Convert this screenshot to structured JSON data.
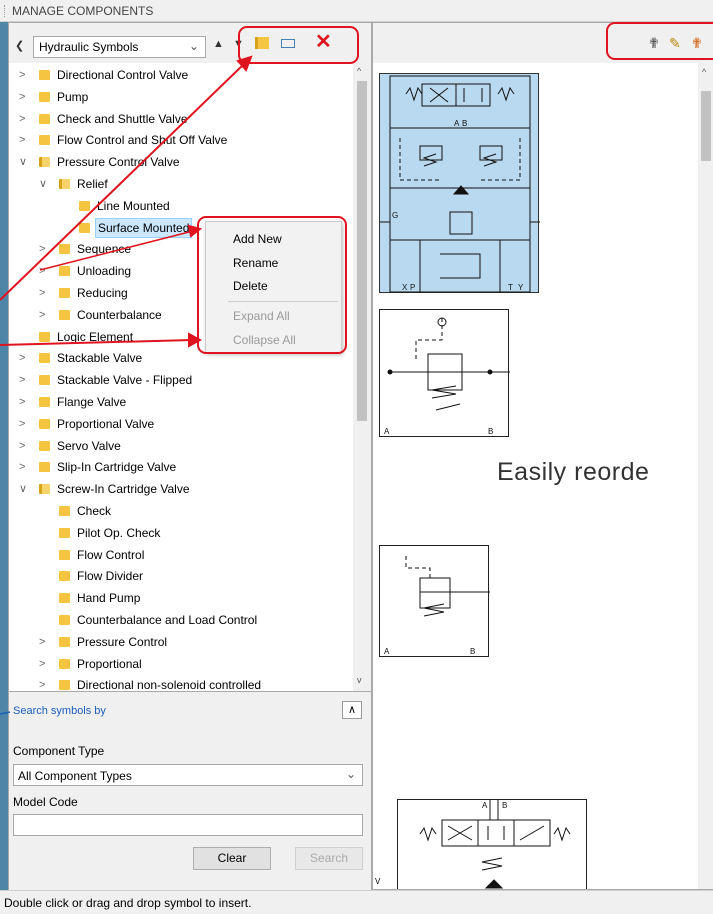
{
  "window": {
    "title": "MANAGE COMPONENTS",
    "status": "Double click or drag and drop symbol to insert."
  },
  "toolbar": {
    "library": "Hydraulic Symbols"
  },
  "tree": [
    {
      "label": "Directional Control Valve",
      "depth": 0,
      "expanded": false
    },
    {
      "label": "Pump",
      "depth": 0,
      "expanded": false
    },
    {
      "label": "Check and Shuttle Valve",
      "depth": 0,
      "expanded": false
    },
    {
      "label": "Flow Control and Shut Off Valve",
      "depth": 0,
      "expanded": false
    },
    {
      "label": "Pressure Control Valve",
      "depth": 0,
      "expanded": true
    },
    {
      "label": "Relief",
      "depth": 1,
      "expanded": true
    },
    {
      "label": "Line Mounted",
      "depth": 2,
      "leaf": true
    },
    {
      "label": "Surface Mounted",
      "depth": 2,
      "leaf": true,
      "selected": true
    },
    {
      "label": "Sequence",
      "depth": 1,
      "expanded": false
    },
    {
      "label": "Unloading",
      "depth": 1,
      "expanded": false
    },
    {
      "label": "Reducing",
      "depth": 1,
      "expanded": false
    },
    {
      "label": "Counterbalance",
      "depth": 1,
      "expanded": false
    },
    {
      "label": "Logic Element",
      "depth": 0,
      "leaf": true
    },
    {
      "label": "Stackable Valve",
      "depth": 0,
      "expanded": false
    },
    {
      "label": "Stackable Valve - Flipped",
      "depth": 0,
      "expanded": false
    },
    {
      "label": "Flange Valve",
      "depth": 0,
      "expanded": false
    },
    {
      "label": "Proportional Valve",
      "depth": 0,
      "expanded": false
    },
    {
      "label": "Servo Valve",
      "depth": 0,
      "expanded": false
    },
    {
      "label": "Slip-In Cartridge Valve",
      "depth": 0,
      "expanded": false
    },
    {
      "label": "Screw-In Cartridge Valve",
      "depth": 0,
      "expanded": true
    },
    {
      "label": "Check",
      "depth": 1,
      "leaf": true
    },
    {
      "label": "Pilot Op. Check",
      "depth": 1,
      "leaf": true
    },
    {
      "label": "Flow Control",
      "depth": 1,
      "leaf": true
    },
    {
      "label": "Flow Divider",
      "depth": 1,
      "leaf": true
    },
    {
      "label": "Hand Pump",
      "depth": 1,
      "leaf": true
    },
    {
      "label": "Counterbalance and Load Control",
      "depth": 1,
      "leaf": true
    },
    {
      "label": "Pressure Control",
      "depth": 1,
      "expanded": false
    },
    {
      "label": "Proportional",
      "depth": 1,
      "expanded": false
    },
    {
      "label": "Directional non-solenoid controlled",
      "depth": 1,
      "expanded": false
    }
  ],
  "context_menu": {
    "add_new": "Add New",
    "rename": "Rename",
    "delete": "Delete",
    "expand_all": "Expand All",
    "collapse_all": "Collapse All"
  },
  "search": {
    "header": "Search symbols by",
    "component_type_label": "Component Type",
    "component_type_value": "All Component Types",
    "model_code_label": "Model Code",
    "model_code_value": "",
    "clear": "Clear",
    "search": "Search"
  },
  "preview": {
    "overlay_text": "Easily reorde",
    "symbol_labels": {
      "a": "A",
      "b": "B",
      "g": "G",
      "t": "T",
      "x": "X",
      "p": "P",
      "y": "Y",
      "v": "V"
    }
  }
}
